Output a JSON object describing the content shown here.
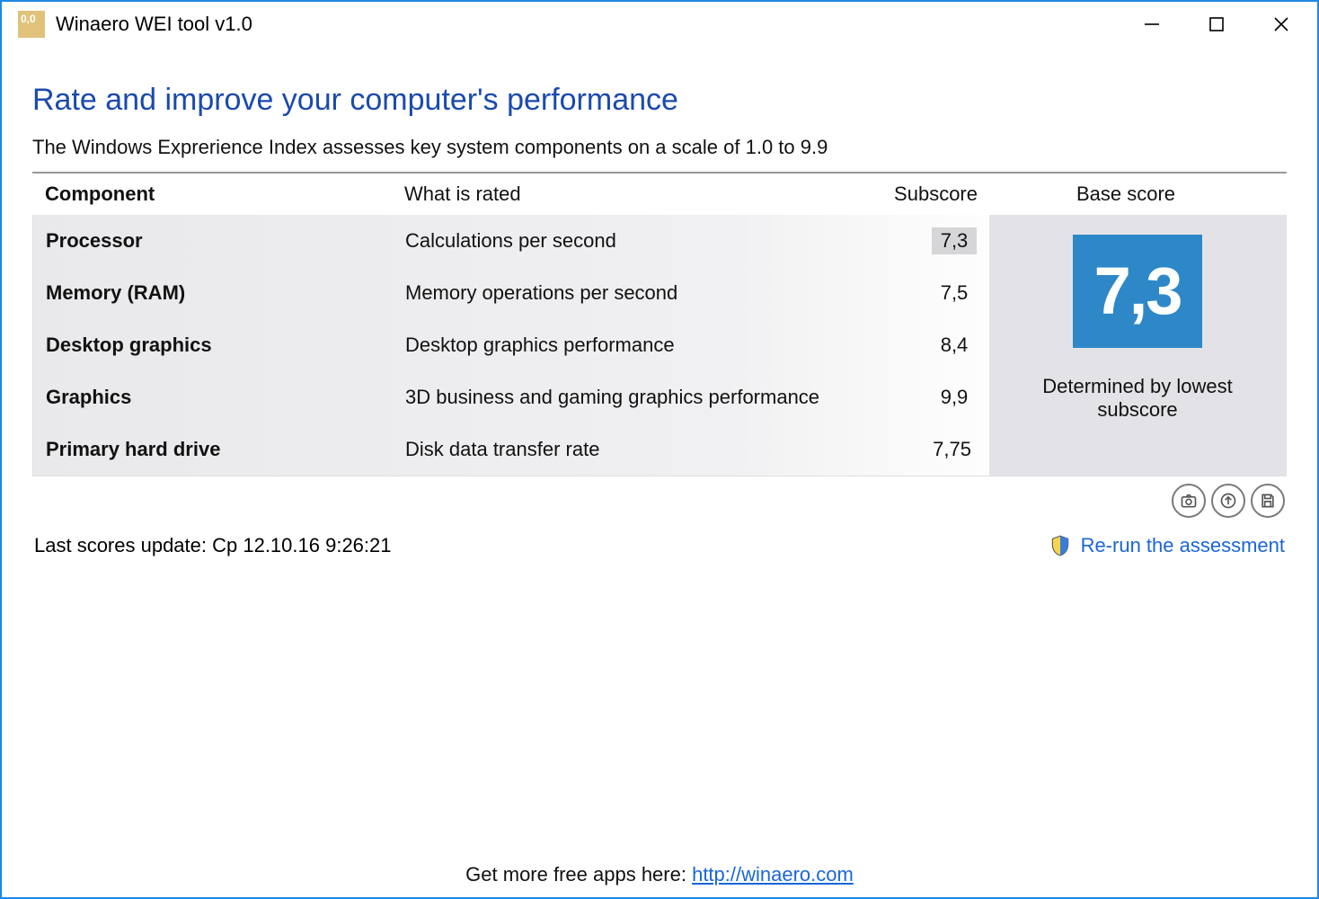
{
  "window": {
    "app_icon_text": "0,0",
    "title": "Winaero WEI tool v1.0"
  },
  "heading": "Rate and improve your computer's performance",
  "subheading": "The Windows Exprerience Index assesses key system components on a scale of 1.0 to 9.9",
  "table": {
    "headers": {
      "component": "Component",
      "rated": "What is rated",
      "subscore": "Subscore",
      "base": "Base score"
    },
    "rows": [
      {
        "component": "Processor",
        "rated": "Calculations per second",
        "subscore": "7,3",
        "lowest": true
      },
      {
        "component": "Memory (RAM)",
        "rated": "Memory operations per second",
        "subscore": "7,5",
        "lowest": false
      },
      {
        "component": "Desktop graphics",
        "rated": "Desktop graphics performance",
        "subscore": "8,4",
        "lowest": false
      },
      {
        "component": "Graphics",
        "rated": "3D business and gaming graphics performance",
        "subscore": "9,9",
        "lowest": false
      },
      {
        "component": "Primary hard drive",
        "rated": "Disk data transfer rate",
        "subscore": "7,75",
        "lowest": false
      }
    ]
  },
  "base_score": {
    "value": "7,3",
    "caption": "Determined by lowest subscore"
  },
  "toolbar": {
    "screenshot": "screenshot",
    "upload": "upload",
    "save": "save"
  },
  "last_update": "Last scores update: Cp 12.10.16 9:26:21",
  "rerun_label": "Re-run the assessment",
  "footer": {
    "text": "Get more free apps here: ",
    "link": "http://winaero.com"
  }
}
